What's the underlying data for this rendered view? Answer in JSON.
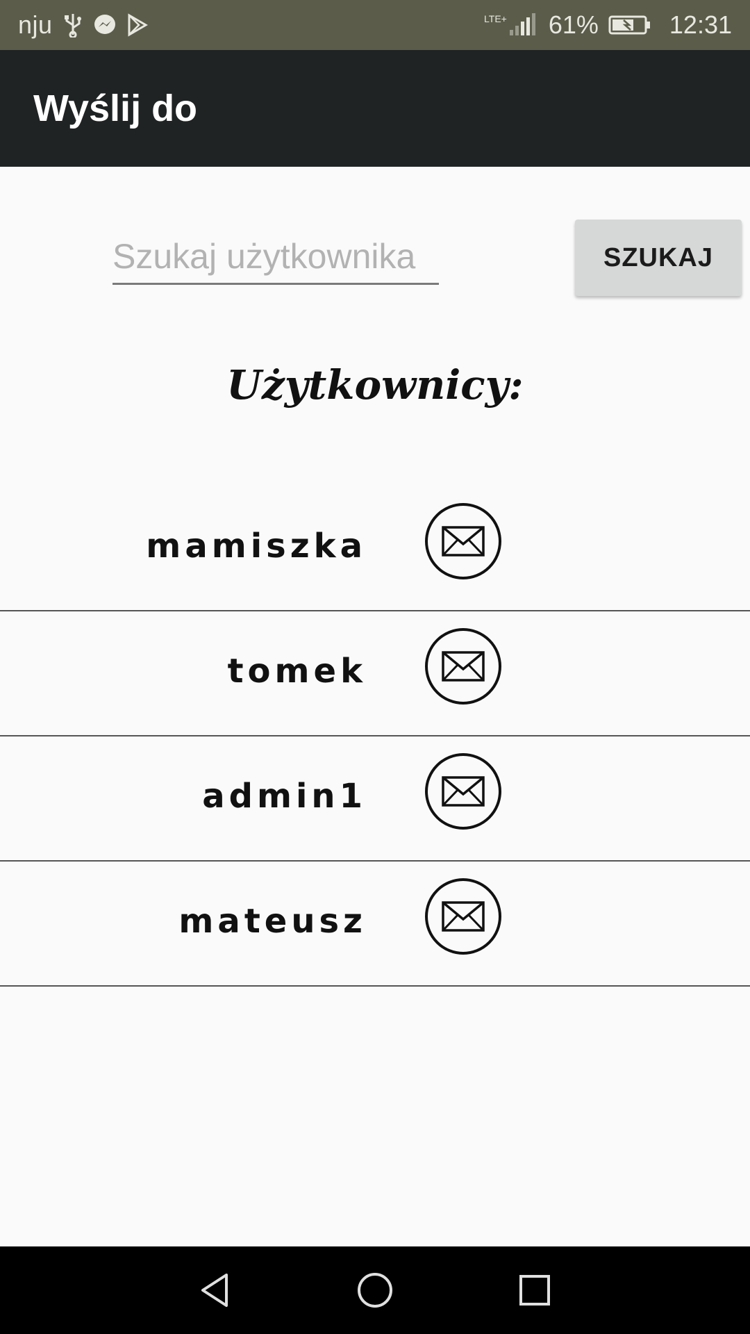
{
  "status_bar": {
    "carrier": "nju",
    "network": "LTE+",
    "battery_percent": "61%",
    "time": "12:31",
    "icons": [
      "usb-icon",
      "messenger-icon",
      "play-store-icon",
      "signal-icon",
      "battery-charging-icon"
    ]
  },
  "app_bar": {
    "title": "Wyślij do"
  },
  "search": {
    "placeholder": "Szukaj użytkownika",
    "value": "",
    "button_label": "SZUKAJ"
  },
  "users_heading": "Użytkownicy:",
  "users": [
    {
      "name": "mamiszka",
      "action_icon": "envelope-icon"
    },
    {
      "name": "tomek",
      "action_icon": "envelope-icon"
    },
    {
      "name": "admin1",
      "action_icon": "envelope-icon"
    },
    {
      "name": "mateusz",
      "action_icon": "envelope-icon"
    }
  ],
  "nav_bar": {
    "buttons": [
      "back-icon",
      "home-icon",
      "recents-icon"
    ]
  },
  "colors": {
    "status_bar": "#5b5c4a",
    "app_bar": "#202324",
    "background": "#fafafa",
    "button": "#d6d7d7"
  }
}
